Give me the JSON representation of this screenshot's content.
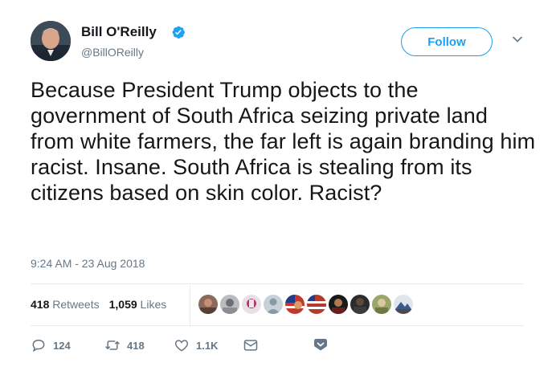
{
  "author": {
    "name": "Bill O'Reilly",
    "handle": "@BillOReilly",
    "verified": true
  },
  "follow_button": {
    "label": "Follow"
  },
  "tweet": {
    "text": "Because President Trump objects to the government of South Africa seizing private land from white farmers, the far left is again branding him racist. Insane. South Africa is stealing from its citizens based on skin color. Racist?",
    "timestamp": "9:24 AM - 23 Aug 2018"
  },
  "stats": {
    "retweets_count": "418",
    "retweets_label": "Retweets",
    "likes_count": "1,059",
    "likes_label": "Likes"
  },
  "actions": {
    "replies": "124",
    "retweets": "418",
    "likes": "1.1K"
  },
  "colors": {
    "accent": "#1da1f2",
    "text": "#14171a",
    "muted": "#657786"
  },
  "icons": [
    "verified-badge-icon",
    "chevron-down-icon",
    "reply-icon",
    "retweet-icon",
    "like-icon",
    "direct-message-icon",
    "bookmark-icon"
  ]
}
